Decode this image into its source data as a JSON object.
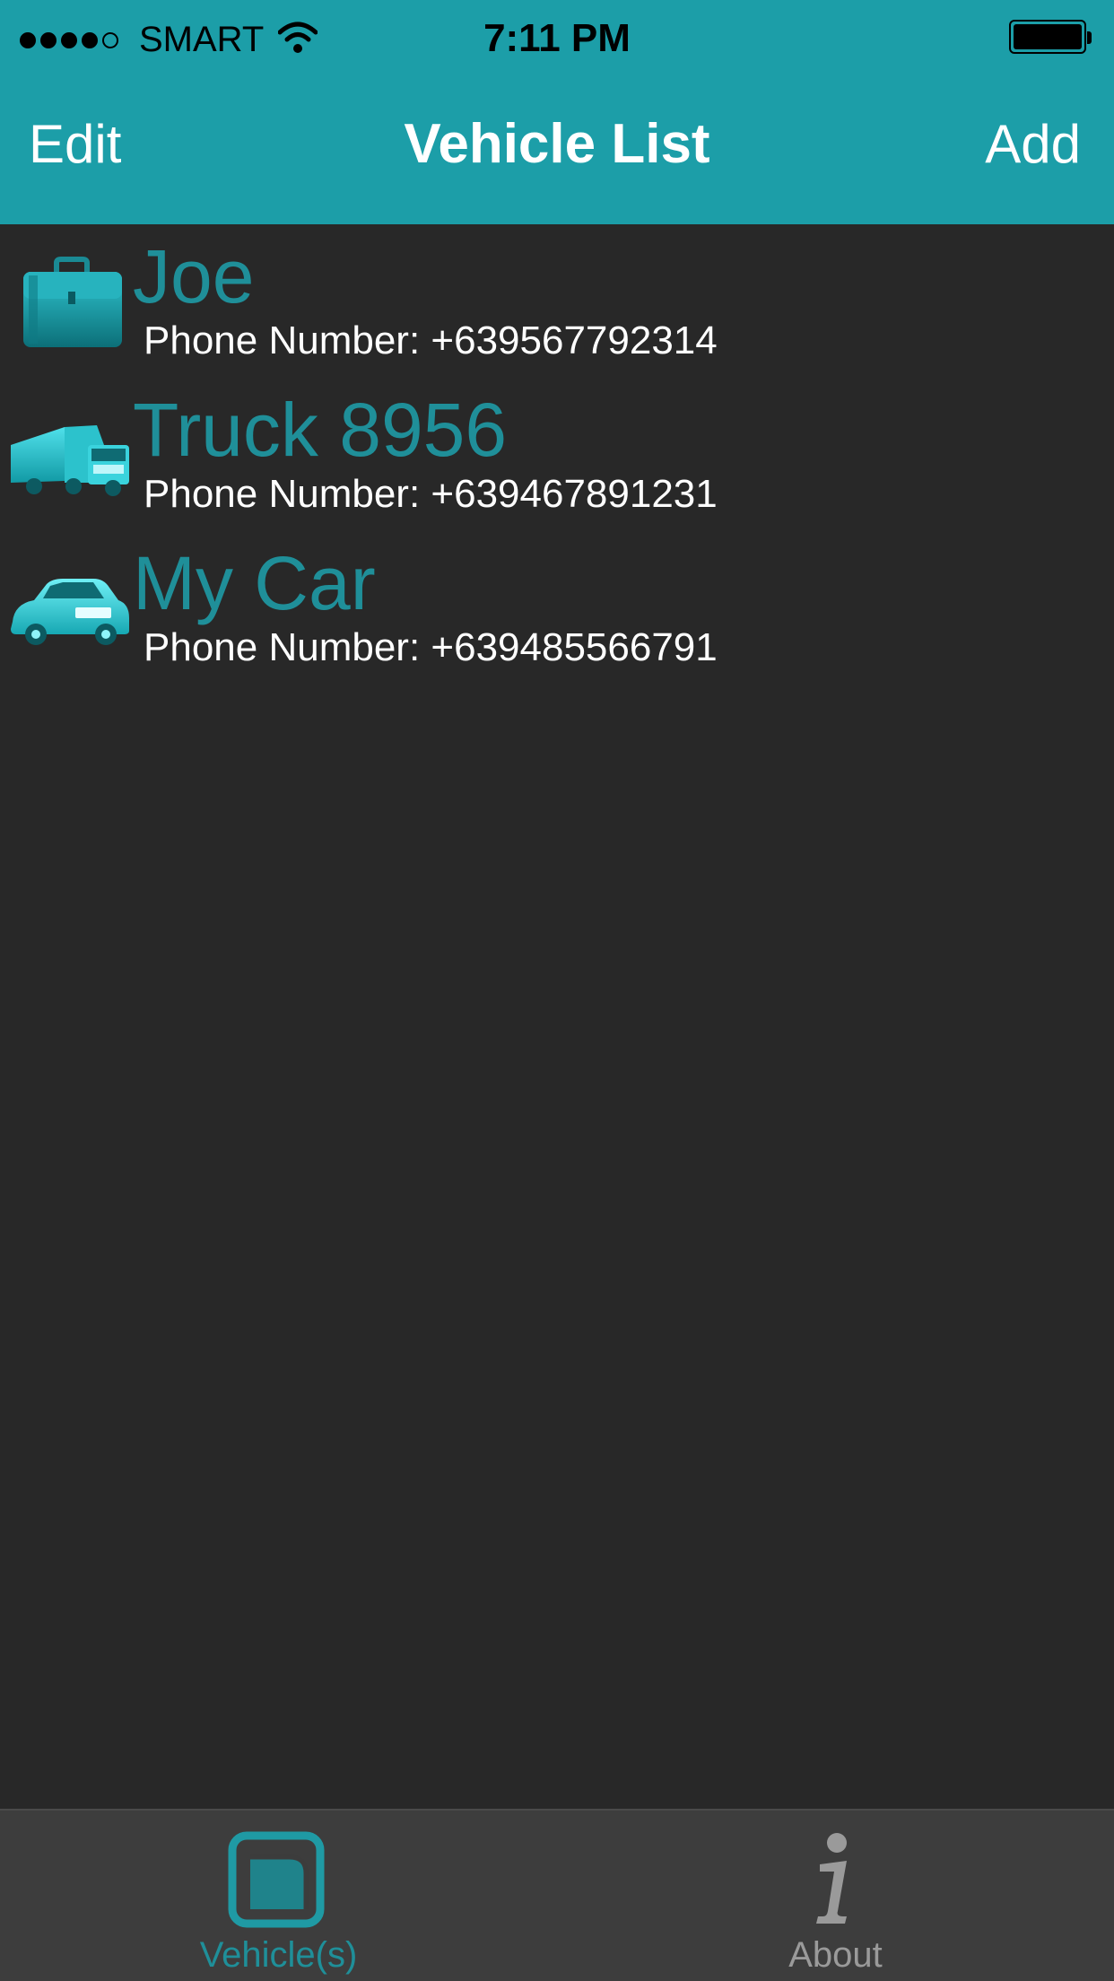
{
  "status_bar": {
    "signal_bars_filled": 4,
    "signal_bars_total": 5,
    "carrier": "SMART",
    "time": "7:11 PM",
    "battery_level": 1.0
  },
  "nav": {
    "edit_label": "Edit",
    "title": "Vehicle List",
    "add_label": "Add"
  },
  "vehicles": [
    {
      "name": "Joe",
      "phone": "Phone Number: +639567792314",
      "icon": "briefcase-icon"
    },
    {
      "name": "Truck 8956",
      "phone": "Phone Number: +639467891231",
      "icon": "truck-icon"
    },
    {
      "name": "My Car",
      "phone": "Phone Number: +639485566791",
      "icon": "car-icon"
    }
  ],
  "tabs": [
    {
      "label": "Vehicle(s)",
      "icon": "vehicles-tab-icon",
      "selected": true
    },
    {
      "label": "About",
      "icon": "info-icon",
      "selected": false
    }
  ],
  "colors": {
    "accent": "#1c9ea8",
    "name_text": "#1f8f99",
    "background": "#282828",
    "tab_bar": "#3d3d3d",
    "tab_inactive": "#9a9a9a"
  }
}
